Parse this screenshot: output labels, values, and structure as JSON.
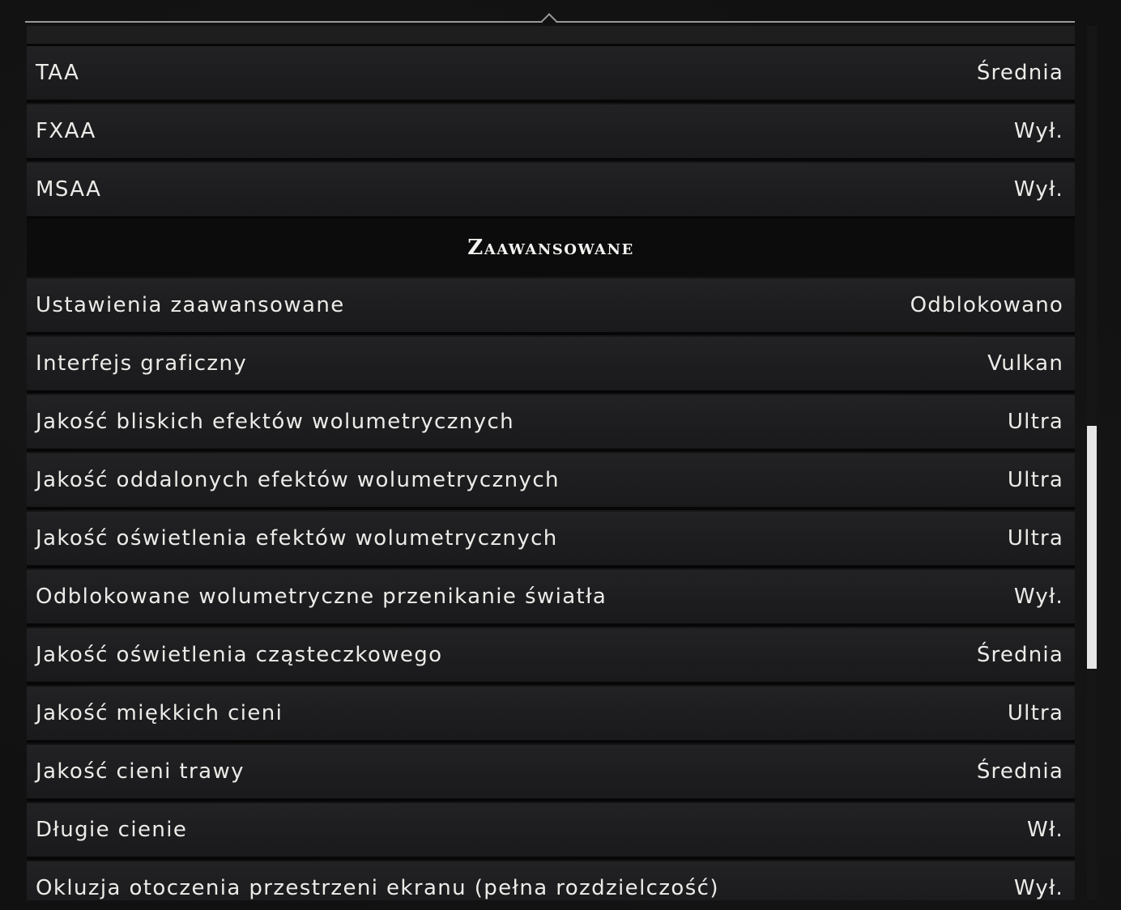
{
  "rows_top": [
    {
      "label": "TAA",
      "value": "Średnia"
    },
    {
      "label": "FXAA",
      "value": "Wył."
    },
    {
      "label": "MSAA",
      "value": "Wył."
    }
  ],
  "section": {
    "title": "Zaawansowane"
  },
  "rows_advanced": [
    {
      "label": "Ustawienia zaawansowane",
      "value": "Odblokowano"
    },
    {
      "label": "Interfejs graficzny",
      "value": "Vulkan"
    },
    {
      "label": "Jakość bliskich efektów wolumetrycznych",
      "value": "Ultra"
    },
    {
      "label": "Jakość oddalonych efektów wolumetrycznych",
      "value": "Ultra"
    },
    {
      "label": "Jakość oświetlenia efektów wolumetrycznych",
      "value": "Ultra"
    },
    {
      "label": "Odblokowane wolumetryczne przenikanie światła",
      "value": "Wył."
    },
    {
      "label": "Jakość oświetlenia cząsteczkowego",
      "value": "Średnia"
    },
    {
      "label": "Jakość miękkich cieni",
      "value": "Ultra"
    },
    {
      "label": "Jakość cieni trawy",
      "value": "Średnia"
    },
    {
      "label": "Długie cienie",
      "value": "Wł."
    },
    {
      "label": "Okluzja otoczenia przestrzeni ekranu (pełna rozdzielczość)",
      "value": "Wył."
    }
  ]
}
